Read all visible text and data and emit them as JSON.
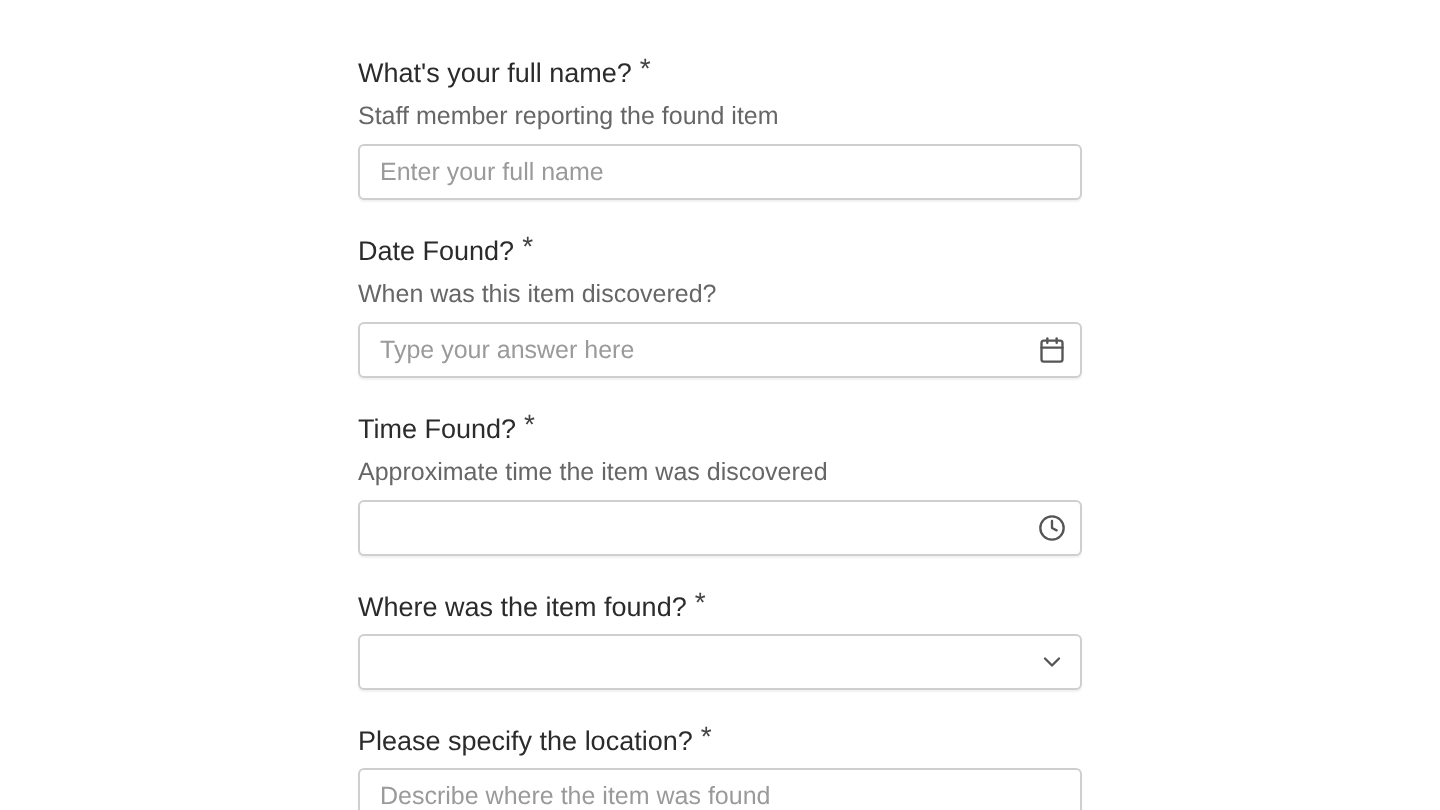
{
  "questions": [
    {
      "kind": "text",
      "label": "What's your full name?",
      "required_mark": "*",
      "description": "Staff member reporting the found item",
      "placeholder": "Enter your full name"
    },
    {
      "kind": "date",
      "label": "Date Found?",
      "required_mark": "*",
      "description": "When was this item discovered?",
      "placeholder": "Type your answer here"
    },
    {
      "kind": "time",
      "label": "Time Found?",
      "required_mark": "*",
      "description": "Approximate time the item was discovered"
    },
    {
      "kind": "select",
      "label": "Where was the item found?",
      "required_mark": "*"
    },
    {
      "kind": "text",
      "label": "Please specify the location?",
      "required_mark": "*",
      "placeholder": "Describe where the item was found"
    }
  ]
}
